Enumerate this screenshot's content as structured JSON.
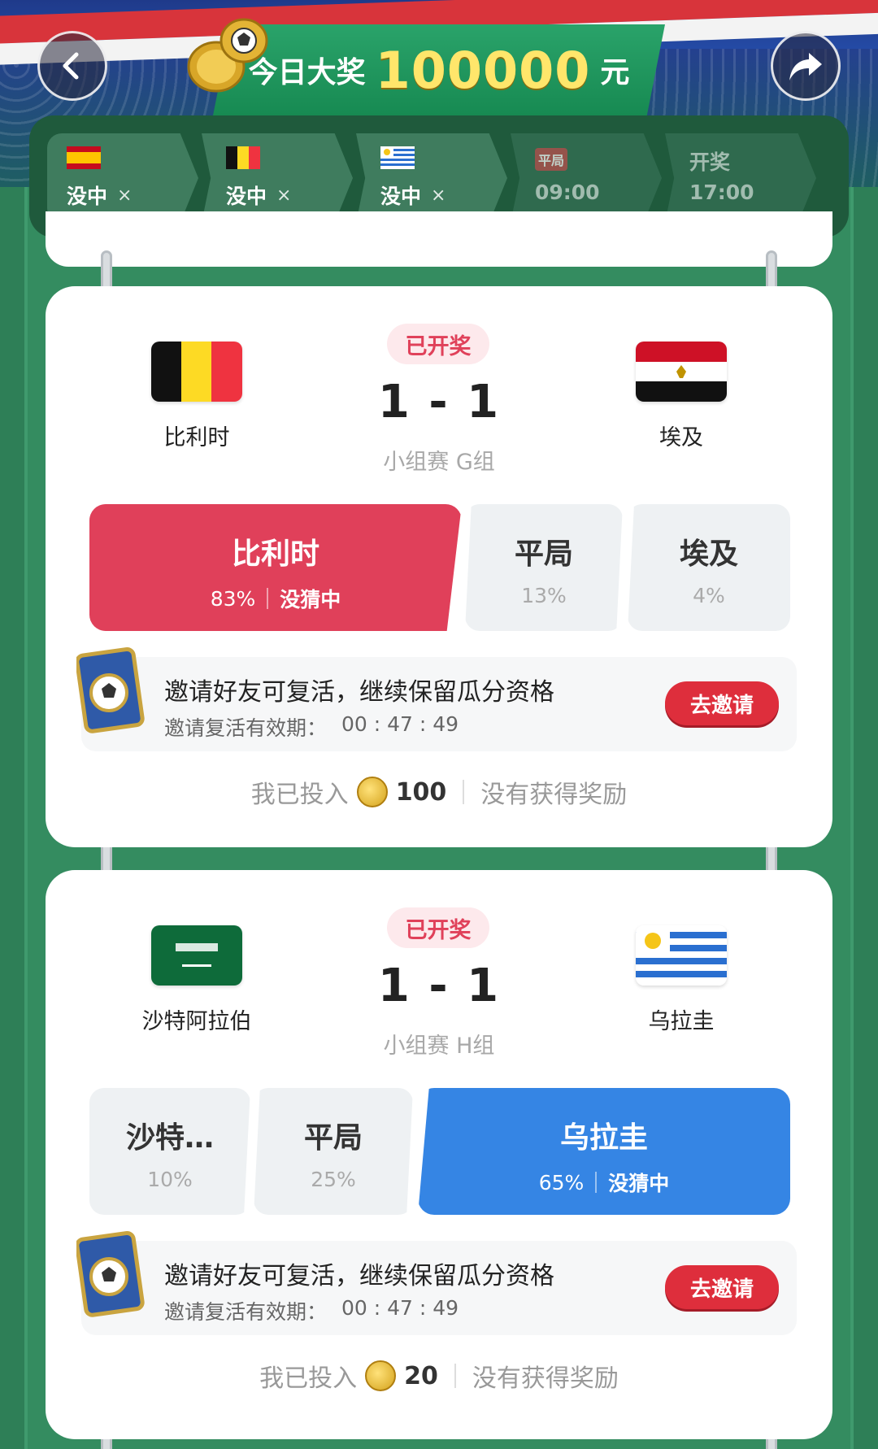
{
  "header": {
    "banner_label": "今日大奖",
    "banner_amount": "100000",
    "banner_unit": "元"
  },
  "steps": [
    {
      "flag": "spain",
      "label": "没中",
      "x": "×"
    },
    {
      "flag": "belgium",
      "label": "没中",
      "x": "×"
    },
    {
      "flag": "uruguay",
      "label": "没中",
      "x": "×"
    },
    {
      "badge": "平局",
      "time": "09:00"
    },
    {
      "top": "开奖",
      "time": "17:00"
    }
  ],
  "matches": [
    {
      "status": "已开奖",
      "home": "比利时",
      "away": "埃及",
      "score": "1 - 1",
      "stage": "小组赛 G组",
      "options": [
        {
          "name": "比利时",
          "pct": "83%",
          "result": "没猜中",
          "selected": true
        },
        {
          "name": "平局",
          "pct": "13%"
        },
        {
          "name": "埃及",
          "pct": "4%"
        }
      ],
      "invite": {
        "title": "邀请好友可复活，继续保留瓜分资格",
        "expiry_label": "邀请复活有效期：",
        "expiry_time": "00 : 47 : 49",
        "button": "去邀请"
      },
      "footer": {
        "invested_label": "我已投入",
        "amount": "100",
        "reward": "没有获得奖励"
      }
    },
    {
      "status": "已开奖",
      "home": "沙特阿拉伯",
      "away": "乌拉圭",
      "score": "1 - 1",
      "stage": "小组赛 H组",
      "options": [
        {
          "name": "沙特…",
          "pct": "10%"
        },
        {
          "name": "平局",
          "pct": "25%"
        },
        {
          "name": "乌拉圭",
          "pct": "65%",
          "result": "没猜中",
          "selected": true
        }
      ],
      "invite": {
        "title": "邀请好友可复活，继续保留瓜分资格",
        "expiry_label": "邀请复活有效期：",
        "expiry_time": "00 : 47 : 49",
        "button": "去邀请"
      },
      "footer": {
        "invested_label": "我已投入",
        "amount": "20",
        "reward": "没有获得奖励"
      }
    }
  ],
  "colors": {
    "red": "#e0405a",
    "blue": "#3585e4",
    "green": "#2f8a5c",
    "invite_btn": "#de2e3c"
  }
}
